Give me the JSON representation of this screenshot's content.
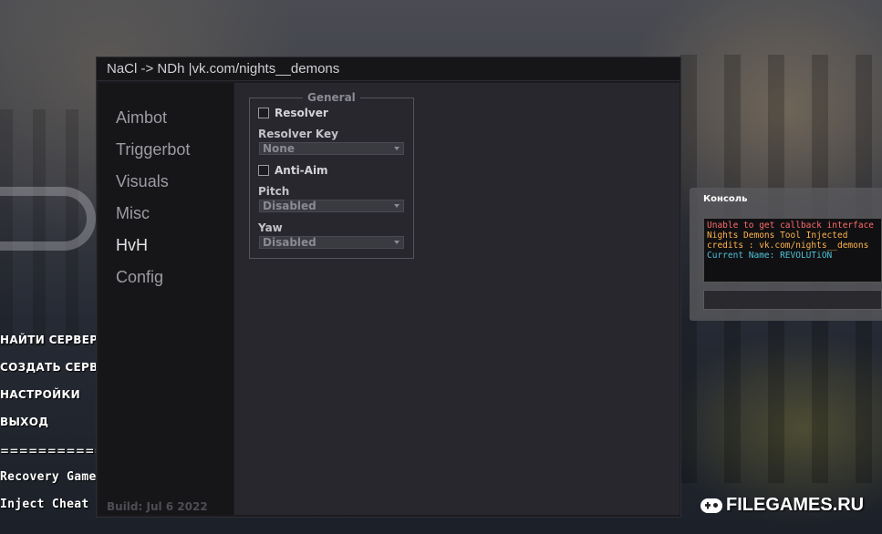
{
  "window": {
    "title": "NaCl -> NDh |vk.com/nights__demons",
    "build": "Build: Jul  6 2022"
  },
  "sidebar": {
    "items": [
      {
        "label": "Aimbot",
        "active": false
      },
      {
        "label": "Triggerbot",
        "active": false
      },
      {
        "label": "Visuals",
        "active": false
      },
      {
        "label": "Misc",
        "active": false
      },
      {
        "label": "HvH",
        "active": true
      },
      {
        "label": "Config",
        "active": false
      }
    ]
  },
  "general": {
    "legend": "General",
    "resolver": {
      "label": "Resolver",
      "checked": false
    },
    "resolver_key": {
      "label": "Resolver Key",
      "value": "None"
    },
    "anti_aim": {
      "label": "Anti-Aim",
      "checked": false
    },
    "pitch": {
      "label": "Pitch",
      "value": "Disabled"
    },
    "yaw": {
      "label": "Yaw",
      "value": "Disabled"
    }
  },
  "console": {
    "title": "Консоль",
    "lines": [
      {
        "text": "Unable to get callback interface",
        "color": "#ff6a6a"
      },
      {
        "text": "Nights Demons Tool Injected",
        "color": "#ffb24a"
      },
      {
        "text": "credits : vk.com/nights__demons",
        "color": "#ffb24a"
      },
      {
        "text": "Current Name: REVOLUTiON",
        "color": "#4ec1d8"
      }
    ]
  },
  "game_menu": {
    "find_servers": "НАЙТИ СЕРВЕРЫ",
    "create_server": "СОЗДАТЬ СЕРВЕ",
    "settings": "НАСТРОЙКИ",
    "exit": "ВЫХОД",
    "separator": "==============",
    "recovery": "Recovery Game",
    "inject": "Inject Cheat"
  },
  "watermark": {
    "text": "FILEGAMES.RU",
    "icon": "gamepad-icon"
  }
}
